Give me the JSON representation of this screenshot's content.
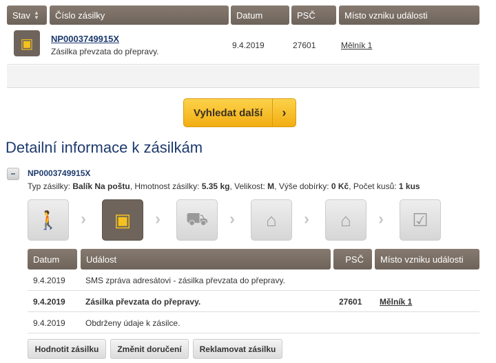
{
  "search_table": {
    "headers": {
      "status": "Stav",
      "number": "Číslo zásilky",
      "date": "Datum",
      "zip": "PSČ",
      "place": "Místo vzniku události"
    },
    "row": {
      "number": "NP0003749915X",
      "status_text": "Zásilka převzata do přepravy.",
      "date": "9.4.2019",
      "zip": "27601",
      "place": "Mělník 1"
    }
  },
  "search_more": {
    "label": "Vyhledat další",
    "arrow": "›"
  },
  "detail": {
    "title": "Detailní informace k zásilkám",
    "toggle": "–",
    "number": "NP0003749915X",
    "info": {
      "type_label": "Typ zásilky: ",
      "type": "Balík Na poštu",
      "weight_label": ", Hmotnost zásilky: ",
      "weight": "5.35 kg",
      "size_label": ", Velikost: ",
      "size": "M",
      "cod_label": ", Výše dobírky: ",
      "cod": "0 Kč",
      "count_label": ", Počet kusů: ",
      "count": "1 kus"
    },
    "steps": [
      {
        "icon": "handover-icon",
        "active": false
      },
      {
        "icon": "hand-truck-icon",
        "active": true
      },
      {
        "icon": "delivery-truck-icon",
        "active": false
      },
      {
        "icon": "depot-icon",
        "active": false
      },
      {
        "icon": "post-office-icon",
        "active": false
      },
      {
        "icon": "delivered-box-icon",
        "active": false
      }
    ],
    "events_headers": {
      "date": "Datum",
      "event": "Událost",
      "zip": "PSČ",
      "place": "Místo vzniku události"
    },
    "events": [
      {
        "date": "9.4.2019",
        "event": "SMS zpráva adresátovi - zásilka převzata do přepravy.",
        "zip": "",
        "place": ""
      },
      {
        "date": "9.4.2019",
        "event": "Zásilka převzata do přepravy.",
        "zip": "27601",
        "place": "Mělník 1"
      },
      {
        "date": "9.4.2019",
        "event": "Obdrženy údaje k zásilce.",
        "zip": "",
        "place": ""
      }
    ],
    "buttons": {
      "rate": "Hodnotit zásilku",
      "change": "Změnit doručení",
      "complain": "Reklamovat zásilku"
    }
  },
  "colors": {
    "header": "#7a6e64",
    "accent": "#f5b820",
    "title": "#1d3a6e"
  }
}
